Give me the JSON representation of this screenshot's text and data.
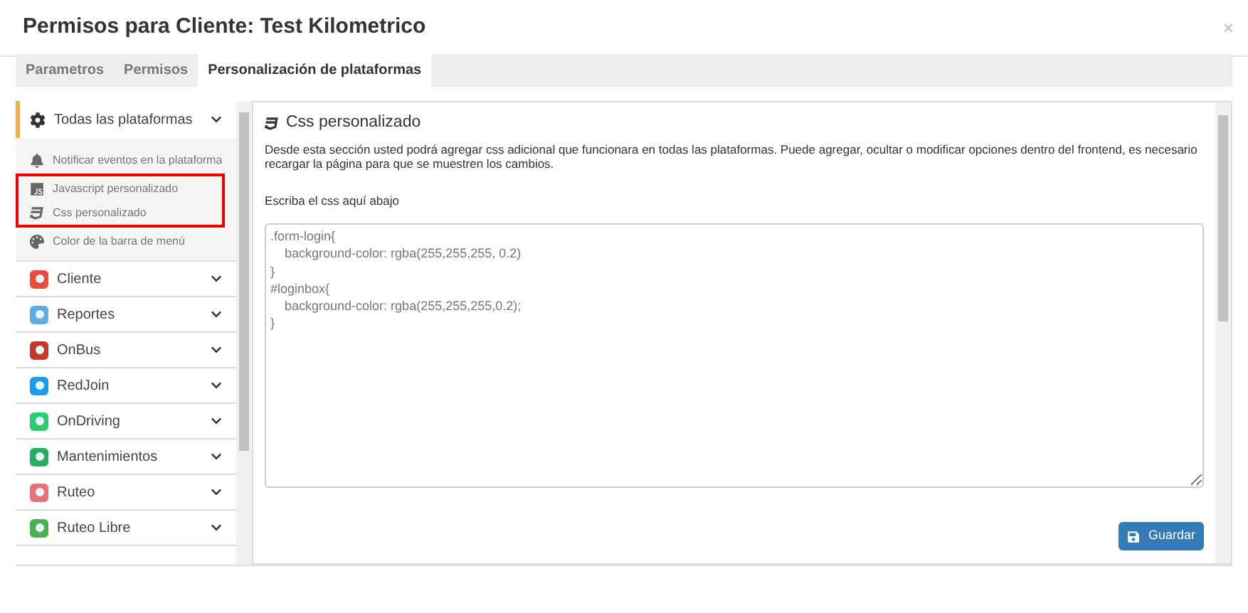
{
  "window": {
    "title": "Permisos para Cliente: Test Kilometrico",
    "close": "×"
  },
  "tabs": [
    {
      "label": "Parametros",
      "selected": false
    },
    {
      "label": "Permisos",
      "selected": false
    },
    {
      "label": "Personalización de plataformas",
      "selected": true
    }
  ],
  "sidebar": {
    "groups": [
      {
        "label": "Todas las plataformas",
        "kind": "gear",
        "expanded": true,
        "children": [
          {
            "label": "Notificar eventos en la plataforma",
            "kind": "bell",
            "highlighted": false
          },
          {
            "label": "Javascript personalizado",
            "kind": "js",
            "highlighted": true
          },
          {
            "label": "Css personalizado",
            "kind": "css",
            "highlighted": true
          },
          {
            "label": "Color de la barra de menú",
            "kind": "palette",
            "highlighted": false
          }
        ]
      },
      {
        "label": "Cliente",
        "kind": "app",
        "expanded": false,
        "color": "#e74c3c"
      },
      {
        "label": "Reportes",
        "kind": "app",
        "expanded": false,
        "color": "#5dade2"
      },
      {
        "label": "OnBus",
        "kind": "app",
        "expanded": false,
        "color": "#c0392b"
      },
      {
        "label": "RedJoin",
        "kind": "app",
        "expanded": false,
        "color": "#1e9be9"
      },
      {
        "label": "OnDriving",
        "kind": "app",
        "expanded": false,
        "color": "#2ecc71"
      },
      {
        "label": "Mantenimientos",
        "kind": "app",
        "expanded": false,
        "color": "#27ae60"
      },
      {
        "label": "Ruteo",
        "kind": "app",
        "expanded": false,
        "color": "#e57373"
      },
      {
        "label": "Ruteo Libre",
        "kind": "app",
        "expanded": false,
        "color": "#4caf50"
      }
    ]
  },
  "content": {
    "title": "Css personalizado",
    "description": "Desde esta sección usted podrá agregar css adicional que funcionara en todas las plataformas. Puede agregar, ocultar o modificar opciones dentro del frontend, es necesario recargar la página para que se muestren los cambios.",
    "field_label": "Escriba el css aquí abajo",
    "code": ".form-login{\n    background-color: rgba(255,255,255, 0.2)\n}\n#loginbox{\n    background-color: rgba(255,255,255,0.2);\n}",
    "save_button": "Guardar"
  }
}
